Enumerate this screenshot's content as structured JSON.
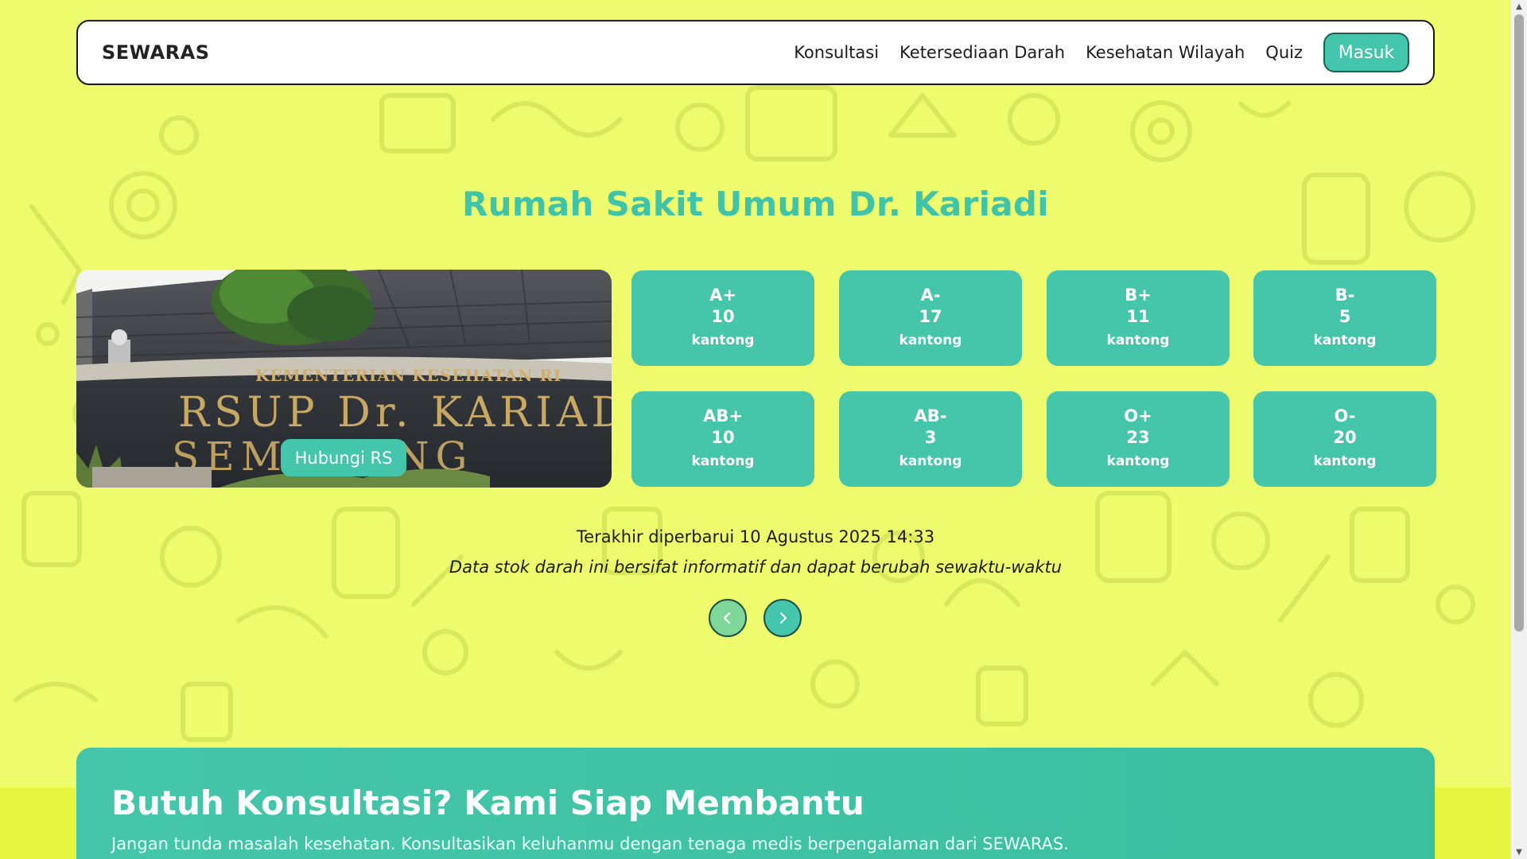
{
  "navbar": {
    "brand": "SEWARAS",
    "links": [
      "Konsultasi",
      "Ketersediaan Darah",
      "Kesehatan Wilayah",
      "Quiz"
    ],
    "login_label": "Masuk"
  },
  "hospital": {
    "name": "Rumah Sakit Umum Dr. Kariadi",
    "photo_sign_line1": "KEMENTERIAN KESEHATAN RI",
    "photo_sign_line2": "RSUP Dr. KARIADI",
    "photo_sign_line3": "SEMARANG",
    "contact_label": "Hubungi RS"
  },
  "blood_stock": [
    {
      "type": "A+",
      "count": "10",
      "unit": "kantong"
    },
    {
      "type": "A-",
      "count": "17",
      "unit": "kantong"
    },
    {
      "type": "B+",
      "count": "11",
      "unit": "kantong"
    },
    {
      "type": "B-",
      "count": "5",
      "unit": "kantong"
    },
    {
      "type": "AB+",
      "count": "10",
      "unit": "kantong"
    },
    {
      "type": "AB-",
      "count": "3",
      "unit": "kantong"
    },
    {
      "type": "O+",
      "count": "23",
      "unit": "kantong"
    },
    {
      "type": "O-",
      "count": "20",
      "unit": "kantong"
    }
  ],
  "last_updated": "Terakhir diperbarui 10 Agustus 2025 14:33",
  "disclaimer": "Data stok darah ini bersifat informatif dan dapat berubah sewaktu-waktu",
  "carousel": {
    "prev_icon": "chevron-left-icon",
    "next_icon": "chevron-right-icon"
  },
  "consultation": {
    "title": "Butuh Konsultasi? Kami Siap Membantu",
    "subtitle": "Jangan tunda masalah kesehatan. Konsultasikan keluhanmu dengan tenaga medis berpengalaman dari SEWARAS."
  },
  "colors": {
    "background": "#eefb6d",
    "accent": "#43c6ac",
    "accent_dark": "#1d5e52",
    "prev_button": "#7fd79a"
  }
}
